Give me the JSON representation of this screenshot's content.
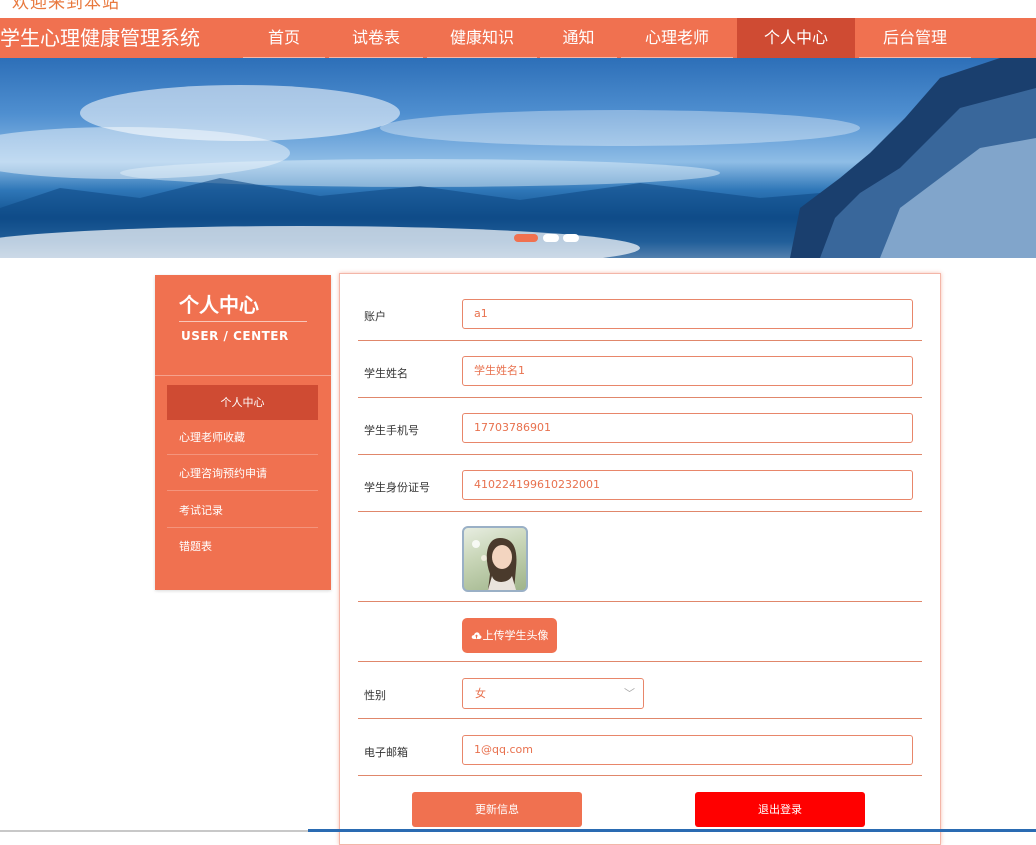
{
  "top_strip": {
    "welcome_text": "欢迎来到本站"
  },
  "header": {
    "site_title": "学生心理健康管理系统",
    "nav": [
      {
        "label": "首页"
      },
      {
        "label": "试卷表"
      },
      {
        "label": "健康知识"
      },
      {
        "label": "通知"
      },
      {
        "label": "心理老师"
      },
      {
        "label": "个人中心",
        "active": true
      },
      {
        "label": "后台管理"
      }
    ]
  },
  "banner": {
    "active_slide": 1,
    "slide_count": 3
  },
  "sidebar": {
    "title": "个人中心",
    "subtitle": "USER / CENTER",
    "items": [
      {
        "label": "个人中心",
        "active": true
      },
      {
        "label": "心理老师收藏"
      },
      {
        "label": "心理咨询预约申请"
      },
      {
        "label": "考试记录"
      },
      {
        "label": "错题表"
      }
    ]
  },
  "form": {
    "account": {
      "label": "账户",
      "value": "a1"
    },
    "student_name": {
      "label": "学生姓名",
      "value": "学生姓名1"
    },
    "phone": {
      "label": "学生手机号",
      "value": "17703786901"
    },
    "id_number": {
      "label": "学生身份证号",
      "value": "410224199610232001"
    },
    "upload_label": "上传学生头像",
    "gender": {
      "label": "性别",
      "value": "女"
    },
    "email": {
      "label": "电子邮箱",
      "value": "1@qq.com"
    },
    "update_label": "更新信息",
    "logout_label": "退出登录"
  },
  "colors": {
    "primary": "#f07150",
    "primary_dark": "#cf4b33",
    "danger": "#ff0000"
  },
  "icons": {
    "upload": "cloud-upload-icon",
    "select": "chevron-down-icon"
  }
}
